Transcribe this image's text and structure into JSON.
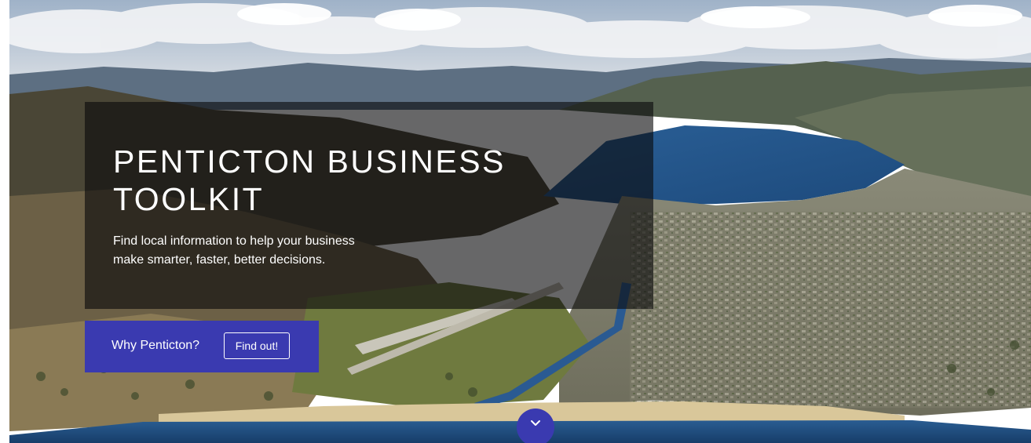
{
  "hero": {
    "title_line1": "PENTICTON BUSINESS",
    "title_line2": "TOOLKIT",
    "subtitle_line1": "Find local information to help your business",
    "subtitle_line2": "make smarter, faster, better decisions."
  },
  "cta": {
    "question": "Why Penticton?",
    "button_label": "Find out!"
  },
  "scroll": {
    "icon": "chevron-down-icon"
  },
  "colors": {
    "accent": "#3a3ab0",
    "panel_overlay": "#0a0a0c",
    "lake": "#1f4f86",
    "text": "#ffffff"
  }
}
